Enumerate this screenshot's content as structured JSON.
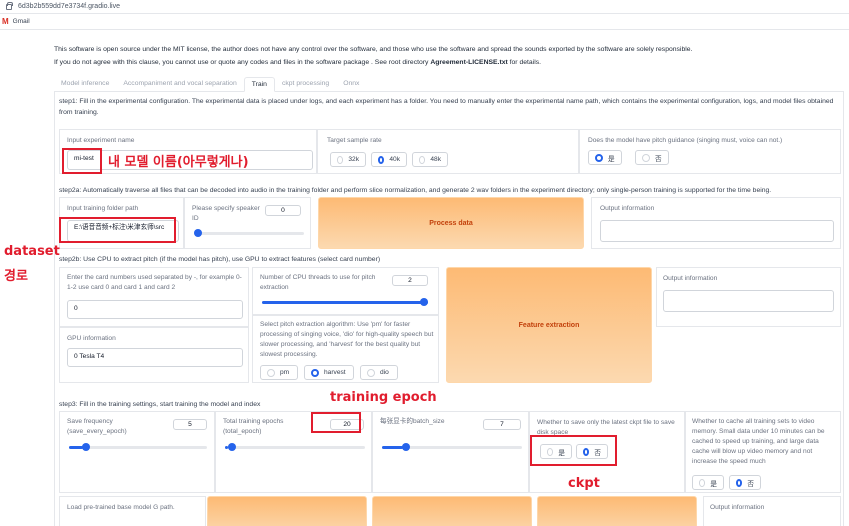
{
  "browser": {
    "url": "6d3b2b559dd7e3734f.gradio.live",
    "bookmark_label": "Gmail",
    "bookmark_icon": "gmail-icon"
  },
  "license": {
    "line1": "This software is open source under the MIT license, the author does not have any control over the software, and those who use the software and spread the sounds exported by the software are solely responsible.",
    "line2_prefix": "If you do not agree with this clause, you cannot use or quote any codes and files in the software package . See root directory ",
    "line2_bold": "Agreement-LICENSE.txt",
    "line2_suffix": " for details."
  },
  "tabs": [
    {
      "label": "Model inference"
    },
    {
      "label": "Accompaniment and vocal separation"
    },
    {
      "label": "Train"
    },
    {
      "label": "ckpt processing"
    },
    {
      "label": "Onnx"
    }
  ],
  "step1": {
    "text": "step1: Fill in the experimental configuration. The experimental data is placed under logs, and each experiment has a folder. You need to manually enter the experimental name path, which contains the experimental configuration, logs, and model files obtained from training.",
    "exp_label": "Input experiment name",
    "exp_value": "mi-test",
    "sr_label": "Target sample rate",
    "sr_options": [
      "32k",
      "40k",
      "48k"
    ],
    "sr_selected": "40k",
    "pitch_label": "Does the model have pitch guidance (singing must, voice can not.)",
    "pitch_options": [
      "是",
      "否"
    ],
    "pitch_selected": "是"
  },
  "step2a": {
    "text": "step2a: Automatically traverse all files that can be decoded into audio in the training folder and perform slice normalization, and generate 2 wav folders in the experiment directory; only single-person training is supported for the time being.",
    "folder_label": "Input training folder path",
    "folder_value": "E:\\语音音频+标注\\米津玄师\\src",
    "speaker_label": "Please specify speaker ID",
    "speaker_value": "0",
    "speaker_level": 0,
    "process_button": "Process data",
    "output_label": "Output information"
  },
  "step2b": {
    "text": "step2b: Use CPU to extract pitch (if the model has pitch), use GPU to extract features (select card number)",
    "cards_label": "Enter the card numbers used separated by -, for example 0-1-2 use card 0 and card 1 and card 2",
    "cards_value": "0",
    "gpu_info_label": "GPU information",
    "gpu_info_value": "0 Tesla T4",
    "cpu_threads_label": "Number of CPU threads to use for pitch extraction",
    "cpu_threads_value": "2",
    "cpu_threads_level": 1.0,
    "algo_label": "Select pitch extraction algorithm: Use 'pm' for faster processing of singing voice, 'dio' for high-quality speech but slower processing, and 'harvest' for the best quality but slowest processing.",
    "algo_options": [
      "pm",
      "harvest",
      "dio"
    ],
    "algo_selected": "harvest",
    "feature_button": "Feature extraction",
    "output_label": "Output information"
  },
  "step3": {
    "text": "step3: Fill in the training settings, start training the model and index",
    "save_freq_label": "Save frequency (save_every_epoch)",
    "save_freq_value": "5",
    "save_freq_level": 0.1,
    "epochs_label": "Total training epochs (total_epoch)",
    "epochs_value": "20",
    "epochs_level": 0.02,
    "batch_label": "每张显卡的batch_size",
    "batch_value": "7",
    "batch_level": 0.15,
    "latest_label": "Whether to save only the latest ckpt file to save disk space",
    "latest_options": [
      "是",
      "否"
    ],
    "latest_selected": "否",
    "cache_label": "Whether to cache all training sets to video memory. Small data under 10 minutes can be cached to speed up training, and large data cache will blow up video memory and not increase the speed much",
    "cache_options": [
      "是",
      "否"
    ],
    "cache_selected": "否",
    "pretrained_label": "Load pre-trained base model G path.",
    "output_label": "Output information"
  },
  "annotations": {
    "model_name": "내 모델 이름(아무렇게나)",
    "dataset_1": "dataset",
    "dataset_2": "경로",
    "training_epoch": "training epoch",
    "ckpt": "ckpt"
  },
  "colors": {
    "accent": "#2563eb",
    "annotation_red": "#e11d2e",
    "orange_button": "#fdba74"
  }
}
